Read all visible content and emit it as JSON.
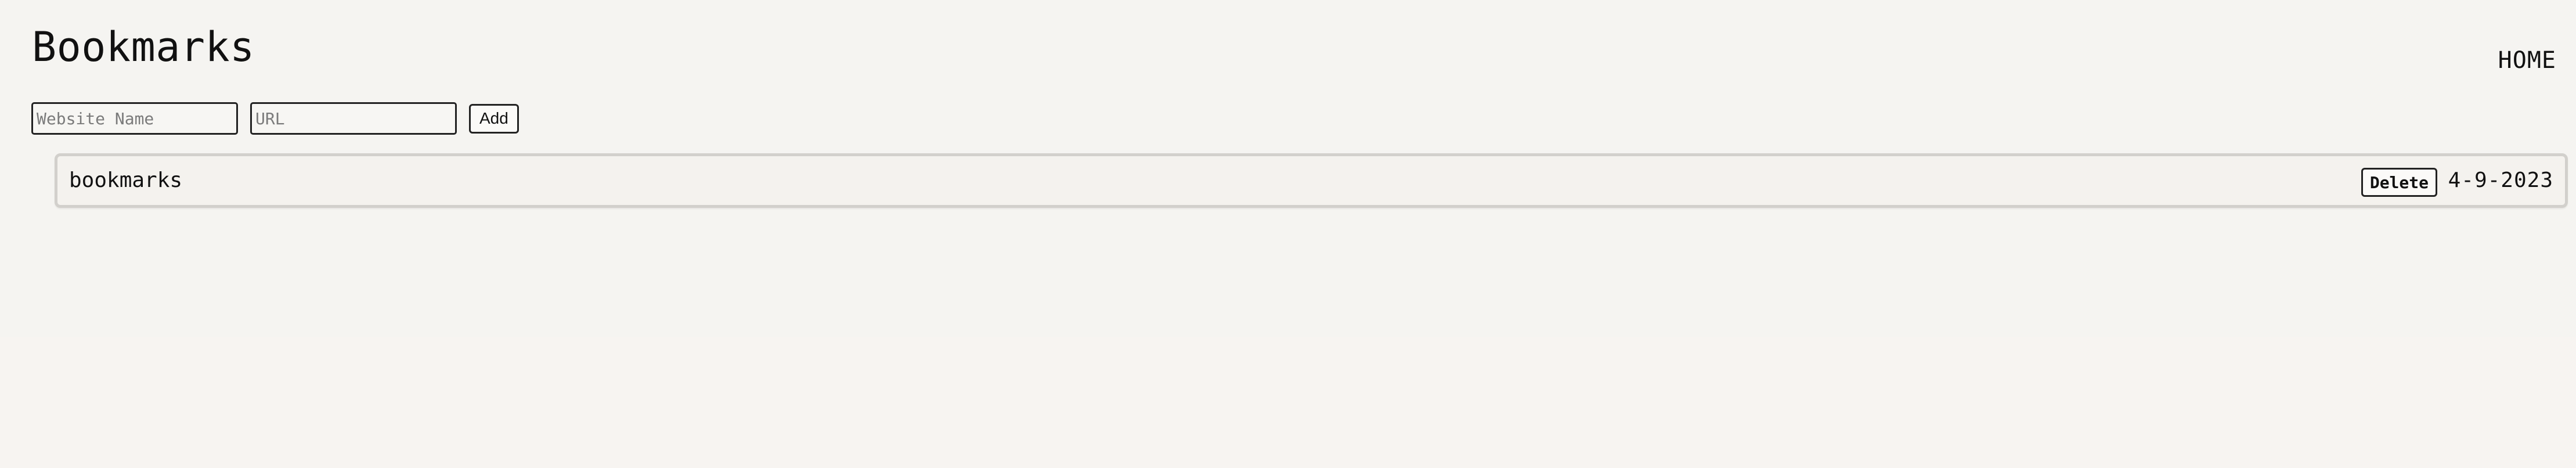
{
  "page": {
    "title": "Bookmarks"
  },
  "nav": {
    "home_label": "HOME"
  },
  "form": {
    "website_name": {
      "value": "",
      "placeholder": "Website Name"
    },
    "url": {
      "value": "",
      "placeholder": "URL"
    },
    "add_label": "Add"
  },
  "bookmarks": [
    {
      "name": "bookmarks",
      "delete_label": "Delete",
      "date": "4-9-2023"
    }
  ],
  "colors": {
    "background": "#f5f4f1",
    "row_background": "#f4f2ee",
    "row_border": "#d2d0cc",
    "text": "#111111"
  }
}
